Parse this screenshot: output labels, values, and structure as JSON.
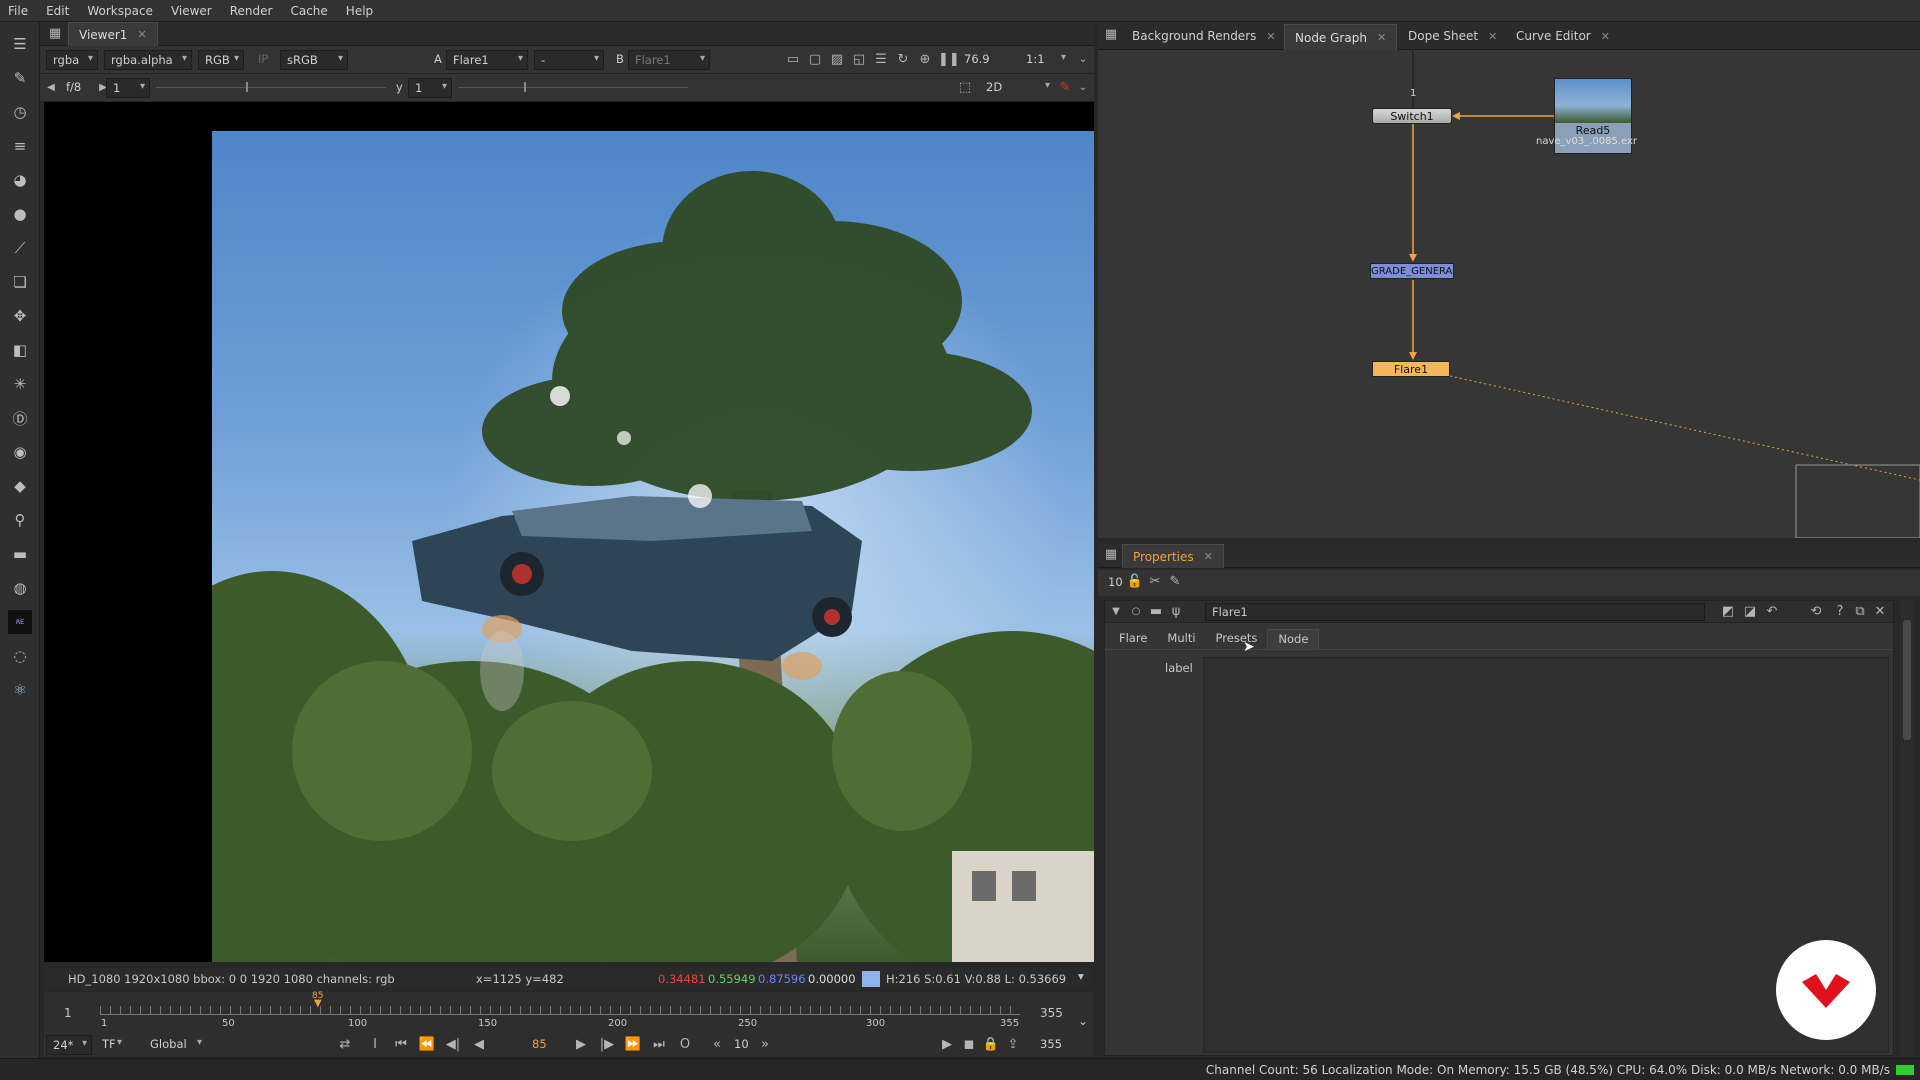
{
  "menu": [
    "File",
    "Edit",
    "Workspace",
    "Viewer",
    "Render",
    "Cache",
    "Help"
  ],
  "toolbar_icons": [
    "layers-stack-icon",
    "brush-icon",
    "clock-icon",
    "menu-lines-icon",
    "color-wheel-icon",
    "circle-icon",
    "curve-icon",
    "layers-icon",
    "move-icon",
    "cube-icon",
    "particles-icon",
    "d-icon",
    "eye-icon",
    "tag-icon",
    "key-icon",
    "folder-icon",
    "globe-icon",
    "revision-logo-icon",
    "spiral-icon",
    "atom-icon"
  ],
  "viewer": {
    "tab_label": "Viewer1",
    "channels": "rgba",
    "alpha": "rgba.alpha",
    "colorspace_rgb": "RGB",
    "ip": "IP",
    "lut": "sRGB",
    "input_a_prefix": "A",
    "input_a": "Flare1",
    "wipe": "-",
    "input_b_prefix": "B",
    "input_b": "Flare1",
    "zoom": "76.9",
    "ratio": "1:1",
    "fstop": "f/8",
    "gain": "1",
    "gamma_prefix": "y",
    "gamma": "1",
    "view_mode": "2D",
    "info": {
      "format": "HD_1080 1920x1080  bbox: 0 0 1920 1080 channels: rgb",
      "coords": "x=1125 y=482",
      "r": "0.34481",
      "g": "0.55949",
      "b": "0.87596",
      "a": "0.00000",
      "hsvl": "H:216 S:0.61 V:0.88  L: 0.53669"
    },
    "timeline": {
      "start": "1",
      "end": "355",
      "current": "85",
      "ticks": [
        "1",
        "50",
        "100",
        "150",
        "200",
        "250",
        "300",
        "355"
      ],
      "fps": "24*",
      "tf": "TF",
      "scope": "Global",
      "step": "10",
      "end_frame": "355"
    }
  },
  "right_tabs": [
    {
      "label": "Background Renders",
      "active": false
    },
    {
      "label": "Node Graph",
      "active": true
    },
    {
      "label": "Dope Sheet",
      "active": false
    },
    {
      "label": "Curve Editor",
      "active": false
    }
  ],
  "nodes": {
    "switch": "Switch1",
    "read": "Read5",
    "read_file": "nave_v03_.0085.exr",
    "grade": "GRADE_GENERAL",
    "flare": "Flare1",
    "switch_input": "1"
  },
  "properties": {
    "tab_label": "Properties",
    "count": "10",
    "node_name": "Flare1",
    "tabs": [
      "Flare",
      "Multi",
      "Presets",
      "Node"
    ],
    "active_tab": "Node",
    "label_field": "label"
  },
  "status": "Channel Count: 56  Localization Mode: On  Memory: 15.5 GB (48.5%)  CPU: 64.0%  Disk: 0.0 MB/s  Network: 0.0 MB/s",
  "colors": {
    "accent": "#f0a040",
    "flare_node": "#f5b65a",
    "grade_node": "#7a8fd6",
    "brand_red": "#e0101c"
  }
}
